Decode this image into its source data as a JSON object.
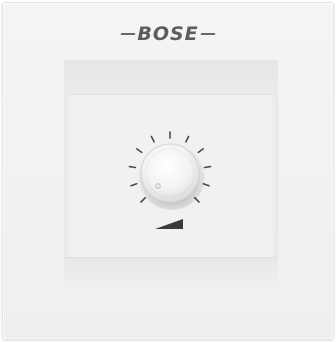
{
  "brand": {
    "logo_text": "BOSE"
  },
  "control": {
    "type": "volume-knob",
    "tick_count": 11,
    "icon": "volume-ramp-icon"
  },
  "colors": {
    "faceplate": "#f2f2f1",
    "knob": "#f7f7f6",
    "ticks": "#4a4a4a",
    "logo": "#5c5c5c"
  }
}
